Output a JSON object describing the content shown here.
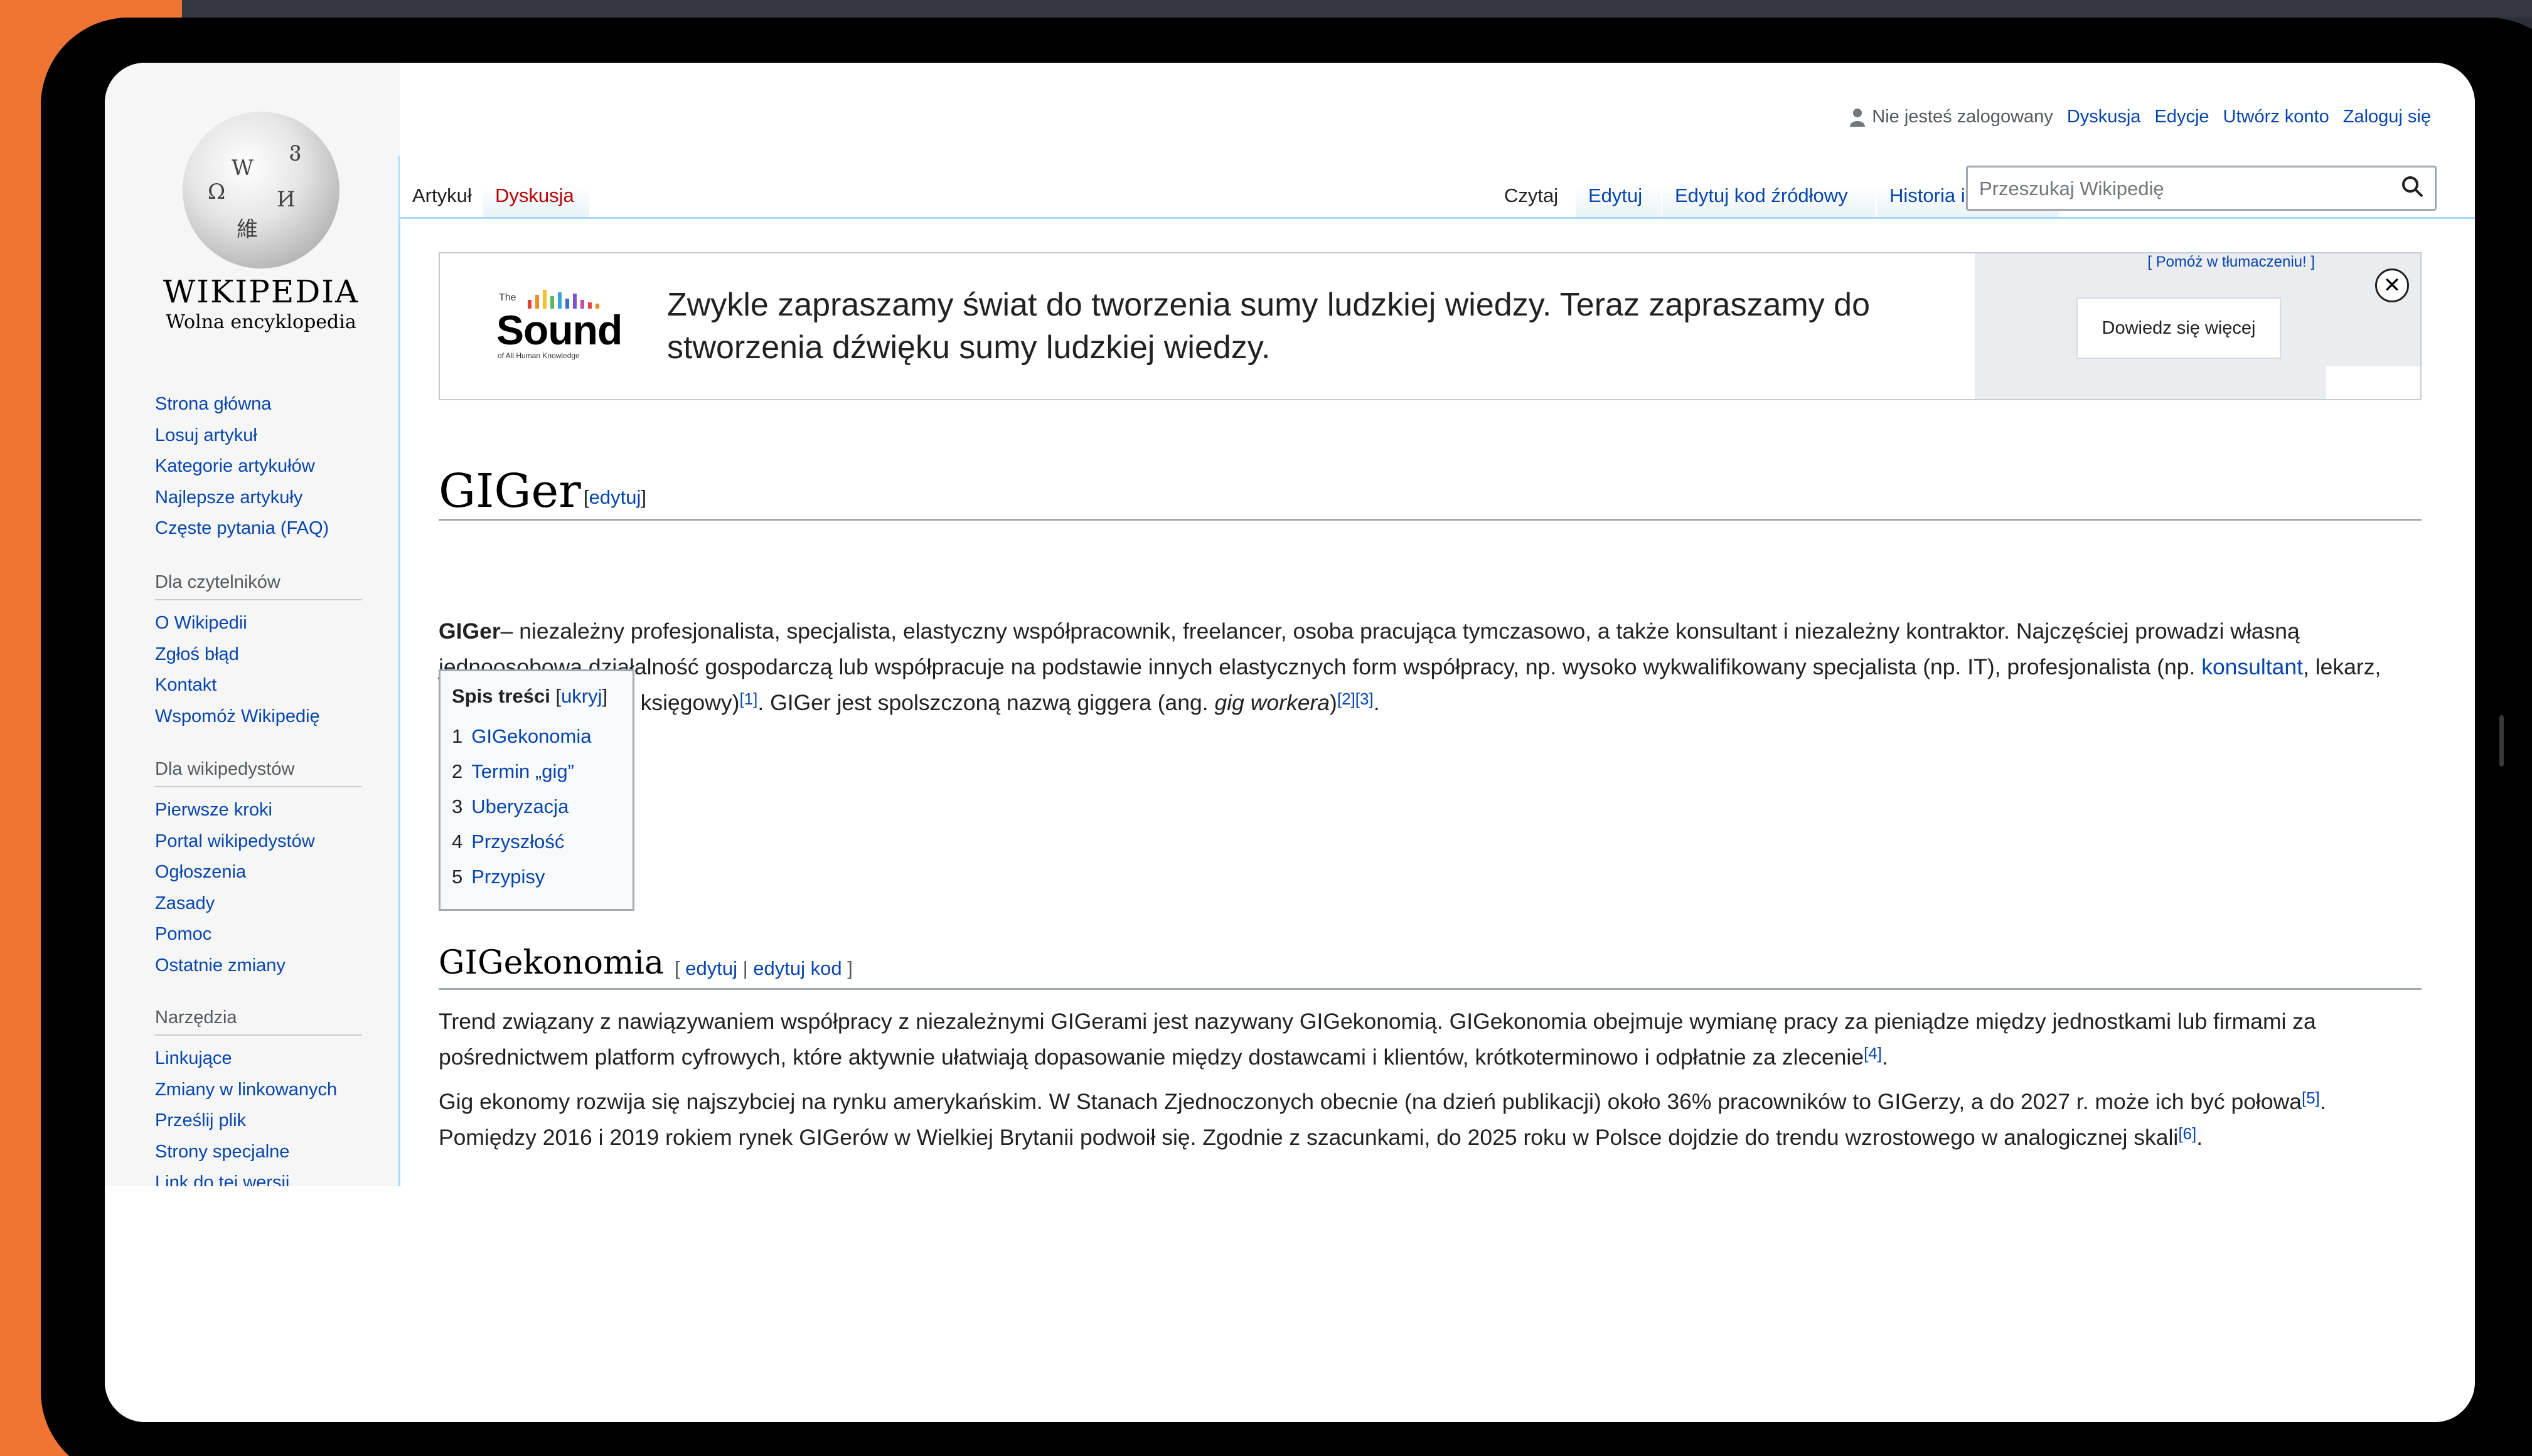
{
  "logo": {
    "wordmark": "WIKIPEDIA",
    "tagline": "Wolna encyklopedia"
  },
  "sidebar": {
    "main": [
      "Strona główna",
      "Losuj artykuł",
      "Kategorie artykułów",
      "Najlepsze artykuły",
      "Częste pytania (FAQ)"
    ],
    "readers": {
      "heading": "Dla czytelników",
      "items": [
        "O Wikipedii",
        "Zgłoś błąd",
        "Kontakt",
        "Wspomóż Wikipedię"
      ]
    },
    "editors": {
      "heading": "Dla wikipedystów",
      "items": [
        "Pierwsze kroki",
        "Portal wikipedystów",
        "Ogłoszenia",
        "Zasady",
        "Pomoc",
        "Ostatnie zmiany"
      ]
    },
    "tools": {
      "heading": "Narzędzia",
      "items": [
        "Linkujące",
        "Zmiany w linkowanych",
        "Prześlij plik",
        "Strony specjalne",
        "Link do tej wersji"
      ]
    }
  },
  "personal": {
    "status": "Nie jesteś zalogowany",
    "links": [
      "Dyskusja",
      "Edycje",
      "Utwórz konto",
      "Zaloguj się"
    ]
  },
  "tabs": {
    "left": [
      "Artykuł",
      "Dyskusja"
    ],
    "right": [
      "Czytaj",
      "Edytuj",
      "Edytuj kod źródłowy",
      "Historia i autorzy"
    ]
  },
  "search": {
    "placeholder": "Przeszukaj Wikipedię"
  },
  "banner": {
    "logo_small": "The",
    "logo_word": "Sound",
    "logo_sub": "of All Human Knowledge",
    "text": "Zwykle zapraszamy świat do tworzenia sumy ludzkiej wiedzy. Teraz zapraszamy do stworzenia dźwięku sumy ludzkiej wiedzy.",
    "help_link": "[ Pomóż w tłumaczeniu! ]",
    "button": "Dowiedz się więcej",
    "close": "✕"
  },
  "article": {
    "title": "GIGer",
    "title_edit": "edytuj",
    "intro": {
      "bold": "GIGer",
      "t1": "– niezależny profesjonalista, specjalista, elastyczny współpracownik, freelancer, osoba pracująca tymczasowo, a także konsultant i niezależny kontraktor. Najczęściej prowadzi własną jednoosobową działalność gospodarczą lub współpracuje na podstawie innych elastycznych form współpracy, np. wysoko wykwalifikowany specjalista (np. IT), profesjonalista (np. ",
      "link": "konsultant",
      "t2": ", lekarz, prawnik, psycholog, księgowy)",
      "ref1": "[1]",
      "t3": ". GIGer jest spolszczoną nazwą giggera (ang. ",
      "italic": "gig workera",
      "t4": ")",
      "ref2": "[2]",
      "ref3": "[3]",
      "t5": "."
    },
    "toc": {
      "title": "Spis treści",
      "toggle": "ukryj",
      "items": [
        {
          "num": "1",
          "label": "GIGekonomia"
        },
        {
          "num": "2",
          "label": "Termin „gig”"
        },
        {
          "num": "3",
          "label": "Uberyzacja"
        },
        {
          "num": "4",
          "label": "Przyszłość"
        },
        {
          "num": "5",
          "label": "Przypisy"
        }
      ]
    },
    "section1": {
      "title": "GIGekonomia",
      "edit": "edytuj",
      "edit_code": "edytuj kod",
      "p1": "Trend związany z nawiązywaniem współpracy z niezależnymi GIGerami jest nazywany GIGekonomią. GIGekonomia obejmuje wymianę pracy za pieniądze między jednostkami lub firmami za pośrednictwem platform cyfrowych, które aktywnie ułatwiają dopasowanie między dostawcami i klientów, krótkoterminowo i odpłatnie za zlecenie",
      "p1_ref": "[4]",
      "p2a": "Gig ekonomy rozwija się najszybciej na rynku amerykańskim. W Stanach Zjednoczonych obecnie (na dzień publikacji) około 36% pracowników to GIGerzy, a do 2027 r. może ich być połowa",
      "p2_ref1": "[5]",
      "p2b": ". Pomiędzy 2016 i 2019 rokiem rynek GIGerów w Wielkiej Brytanii podwoił się. Zgodnie z szacunkami, do 2025 roku w Polsce dojdzie do trendu wzrostowego w analogicznej skali",
      "p2_ref2": "[6]"
    }
  }
}
